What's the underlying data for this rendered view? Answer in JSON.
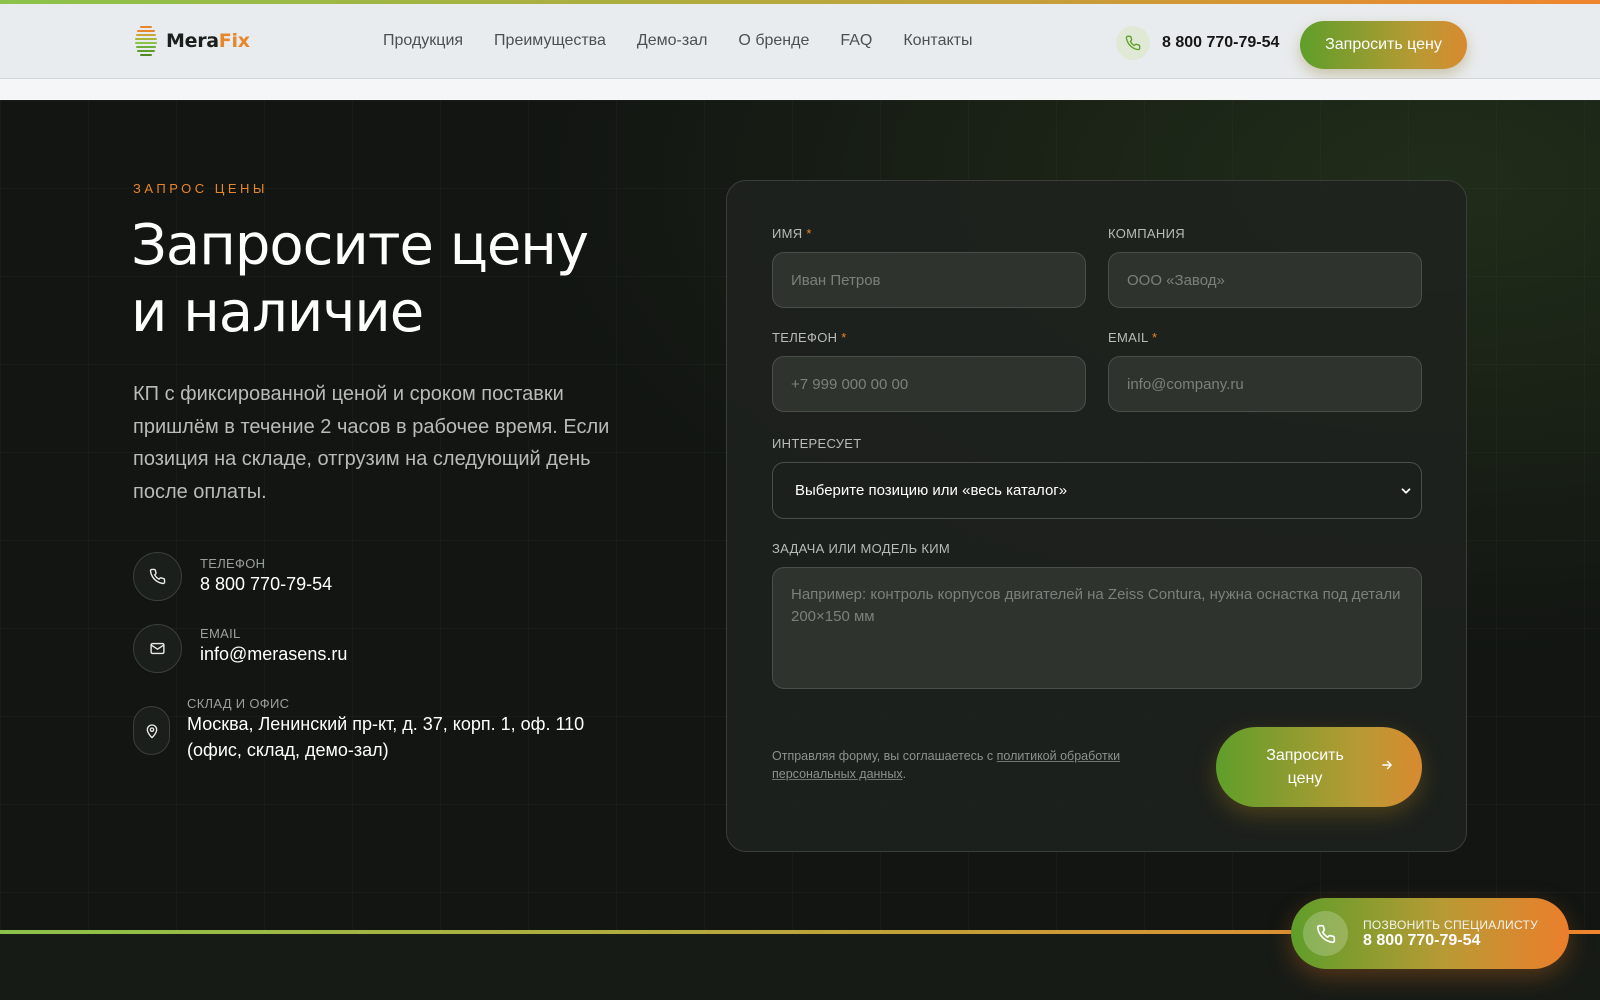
{
  "header": {
    "logo_part1": "Mera",
    "logo_part2": "Fix",
    "nav": [
      "Продукция",
      "Преимущества",
      "Демо-зал",
      "О бренде",
      "FAQ",
      "Контакты"
    ],
    "phone": "8 800 770-79-54",
    "cta": "Запросить цену"
  },
  "hero": {
    "eyebrow": "ЗАПРОС ЦЕНЫ",
    "title_line1": "Запросите цену",
    "title_line2": "и наличие",
    "lead": "КП с фиксированной ценой и сроком поставки пришлём в течение 2 часов в рабочее время. Если позиция на складе, отгрузим на следующий день после оплаты."
  },
  "contacts": {
    "phone_label": "ТЕЛЕФОН",
    "phone_value": "8 800 770-79-54",
    "email_label": "EMAIL",
    "email_value": "info@merasens.ru",
    "address_label": "СКЛАД И ОФИС",
    "address_line1": "Москва, Ленинский пр-кт, д. 37, корп. 1, оф. 110",
    "address_line2": "(офис, склад, демо-зал)"
  },
  "form": {
    "name_label": "ИМЯ",
    "name_placeholder": "Иван Петров",
    "company_label": "КОМПАНИЯ",
    "company_placeholder": "ООО «Завод»",
    "phone_label": "ТЕЛЕФОН",
    "phone_placeholder": "+7 999 000 00 00",
    "email_label": "EMAIL",
    "email_placeholder": "info@company.ru",
    "required_mark": "*",
    "interest_label": "ИНТЕРЕСУЕТ",
    "interest_value": "Выберите позицию или «весь каталог»",
    "task_label": "ЗАДАЧА ИЛИ МОДЕЛЬ КИМ",
    "task_placeholder": "Например: контроль корпусов двигателей на Zeiss Contura, нужна оснастка под детали 200×150 мм",
    "consent_text": "Отправляя форму, вы соглашаетесь с ",
    "consent_link": "политикой обработки персональных данных",
    "consent_end": ".",
    "submit": "Запросить цену"
  },
  "float_call": {
    "label": "ПОЗВОНИТЬ СПЕЦИАЛИСТУ",
    "phone": "8 800 770-79-54"
  },
  "colors": {
    "accent_orange": "#e8862c",
    "accent_green": "#5f9e2a",
    "dark_bg": "#121512",
    "header_bg": "#e9ecee"
  },
  "icons": [
    "phone-icon",
    "mail-icon",
    "map-pin-icon",
    "chevron-down-icon",
    "arrow-right-icon"
  ]
}
